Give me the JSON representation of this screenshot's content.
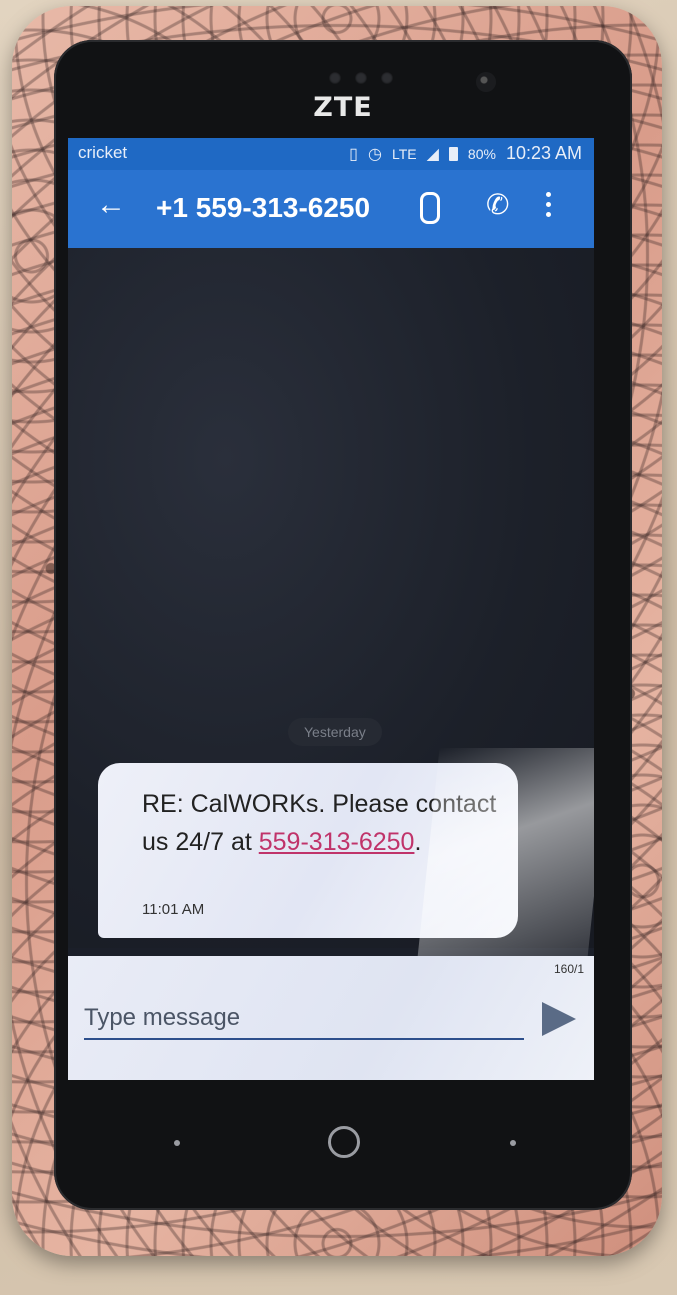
{
  "device": {
    "brand": "ZTE"
  },
  "status_bar": {
    "carrier": "cricket",
    "network": "LTE",
    "battery": "80%",
    "time": "10:23 AM"
  },
  "toolbar": {
    "back_icon": "arrow-left-icon",
    "title": "+1 559-313-6250",
    "attach_icon": "paperclip-icon",
    "call_icon": "phone-icon",
    "more_icon": "more-vertical-icon"
  },
  "conversation": {
    "date_divider": "Yesterday",
    "messages": [
      {
        "text_before_link": "RE: CalWORKs. Please contact us 24/7 at ",
        "link": "559-313-6250",
        "text_after_link": ".",
        "time": "11:01 AM"
      }
    ]
  },
  "compose": {
    "counter": "160/1",
    "placeholder": "Type message",
    "send_icon": "send-icon"
  },
  "colors": {
    "toolbar": "#2a73d0",
    "status_bar": "#1f69c4",
    "link": "#c0336a"
  }
}
